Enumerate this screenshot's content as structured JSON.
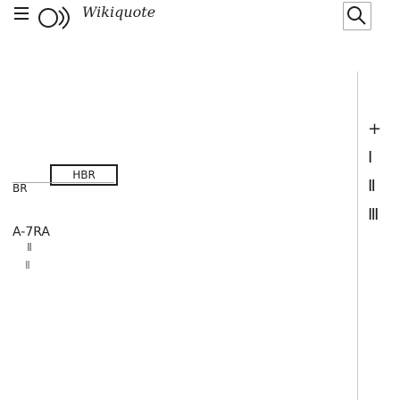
{
  "header": {
    "menu_icon": "menu-icon",
    "logo_icon": "wikipedia-globe-icon",
    "wordmark": "Wikiquote",
    "search_icon": "search-icon"
  },
  "tabs": {
    "article_label": "BR",
    "talk_label": "HBR"
  },
  "content": {
    "title": "A-7RA",
    "hint": "Ⅱ",
    "small": "Ⅱ"
  },
  "right_column": {
    "lines": [
      "+",
      "Ⅰ",
      "Ⅱ",
      "Ⅲ"
    ]
  },
  "colors": {
    "text": "#202122",
    "border": "#a2a9b1"
  }
}
